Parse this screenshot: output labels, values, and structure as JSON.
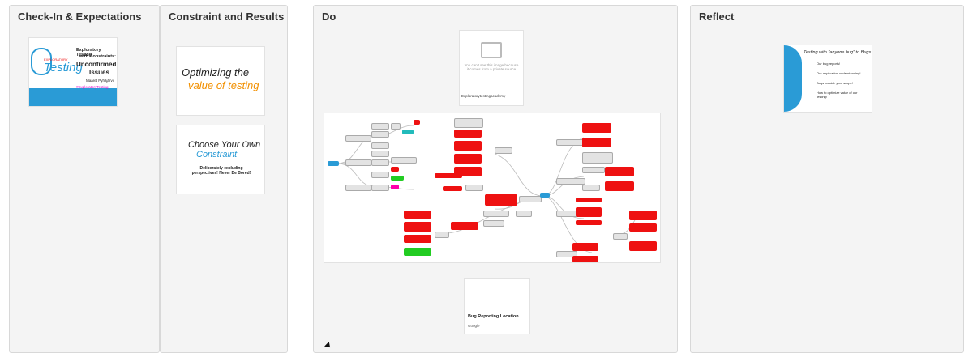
{
  "columns": [
    {
      "title": "Check-In & Expectations"
    },
    {
      "title": "Constraint and Results"
    },
    {
      "title": "Do"
    },
    {
      "title": "Reflect"
    }
  ],
  "checkin_card": {
    "badge": "EXPLORATORY",
    "brand": "Testing",
    "line1": "Exploratory Testing",
    "line2": "with Constraints:",
    "line3": "Unconfirmed",
    "line4": "Issues",
    "author": "Maaret Pyhäjärvi",
    "handle": "#ExploratoryTesting"
  },
  "constraint_cards": [
    {
      "line1": "Optimizing the",
      "line2": "value of testing"
    },
    {
      "line1": "Choose Your Own",
      "line2": "Constraint",
      "subtitle": "Deliberately excluding perspectives! Never Be Bored!"
    }
  ],
  "do_cards": {
    "broken_image": {
      "message": "You can't see this image because it comes from a private source",
      "source": "Exploratorytestingacademy"
    },
    "bug_location": {
      "title": "Bug Reporting Location",
      "source": "Google"
    }
  },
  "reflect_card": {
    "title": "Testing with \"anyone bug\" to Bugs",
    "items": [
      "Our bug reports!",
      "Our application understanding!",
      "Bugs outside your scope!",
      "How to optimize value of our testing!"
    ]
  },
  "colors": {
    "accent": "#2a9bd6",
    "red": "#e11",
    "green": "#2c2"
  }
}
